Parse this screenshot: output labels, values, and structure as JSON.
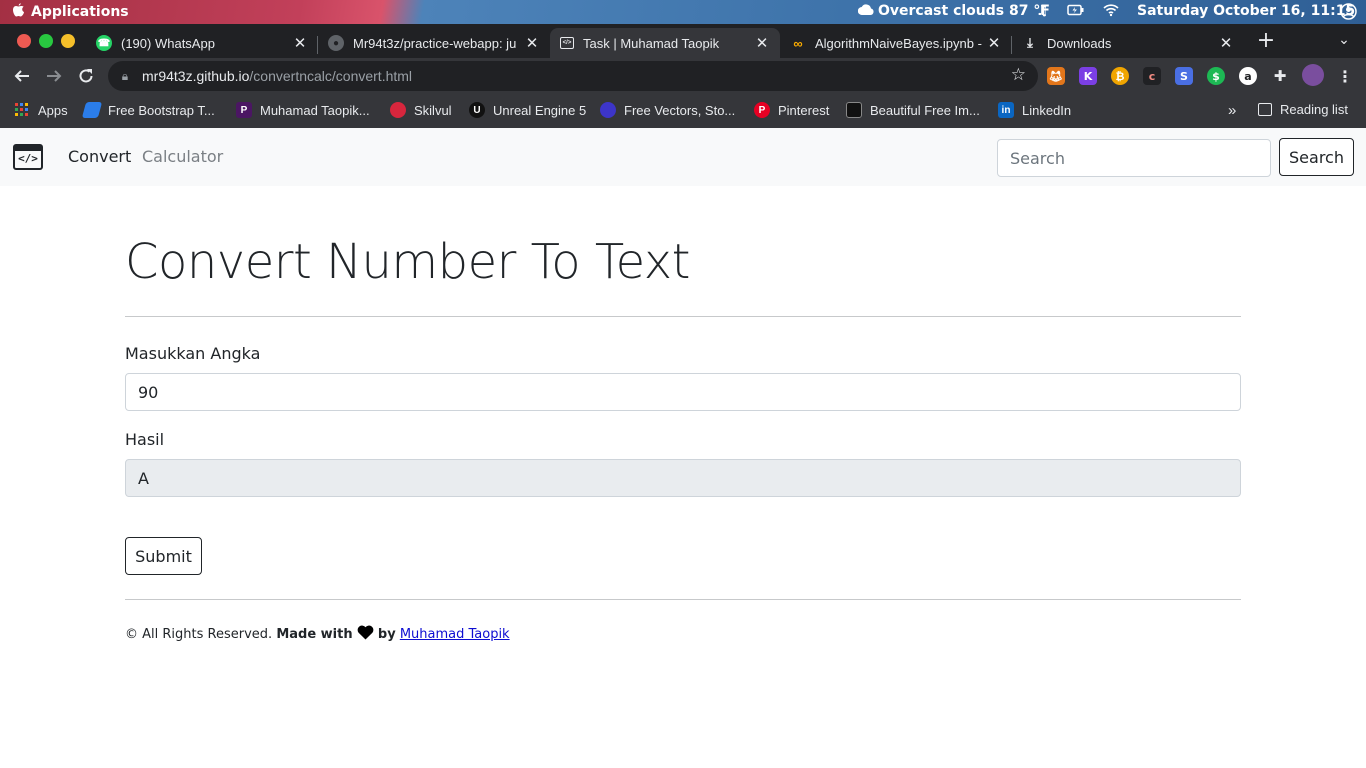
{
  "os_panel": {
    "apps_label": "Applications",
    "weather": "Overcast clouds 87 °F",
    "clock": "Saturday October 16, 11:15"
  },
  "tabs": [
    {
      "title": "(190) WhatsApp",
      "icon": "whatsapp-icon"
    },
    {
      "title": "Mr94t3z/practice-webapp: ju",
      "icon": "github-icon"
    },
    {
      "title": "Task | Muhamad Taopik",
      "icon": "code-window-icon"
    },
    {
      "title": "AlgorithmNaiveBayes.ipynb -",
      "icon": "colab-icon"
    },
    {
      "title": "Downloads",
      "icon": "download-icon"
    }
  ],
  "omnibox": {
    "host": "mr94t3z.github.io",
    "path": "/convertncalc/convert.html"
  },
  "bookmarks": {
    "items": [
      {
        "label": "Apps",
        "icon": "apps-grid-icon"
      },
      {
        "label": "Free Bootstrap T...",
        "icon": "bootstrap-icon"
      },
      {
        "label": "Muhamad Taopik...",
        "icon": "profile-icon"
      },
      {
        "label": "Skilvul",
        "icon": "skilvul-icon"
      },
      {
        "label": "Unreal Engine 5",
        "icon": "unreal-icon"
      },
      {
        "label": "Free Vectors, Sto...",
        "icon": "vector-icon"
      },
      {
        "label": "Pinterest",
        "icon": "pinterest-icon"
      },
      {
        "label": "Beautiful Free Im...",
        "icon": "unsplash-icon"
      },
      {
        "label": "LinkedIn",
        "icon": "linkedin-icon"
      }
    ],
    "overflow": "»",
    "reading_list": "Reading list"
  },
  "navbar": {
    "links": [
      "Convert",
      "Calculator"
    ],
    "search_placeholder": "Search",
    "search_button": "Search"
  },
  "main": {
    "title": "Convert Number To Text",
    "input_label": "Masukkan Angka",
    "input_value": "90",
    "result_label": "Hasil",
    "result_value": "A",
    "submit_label": "Submit"
  },
  "footer": {
    "rights": "© All Rights Reserved.",
    "made_with": "Made with",
    "by": "by",
    "author": "Muhamad Taopik"
  }
}
